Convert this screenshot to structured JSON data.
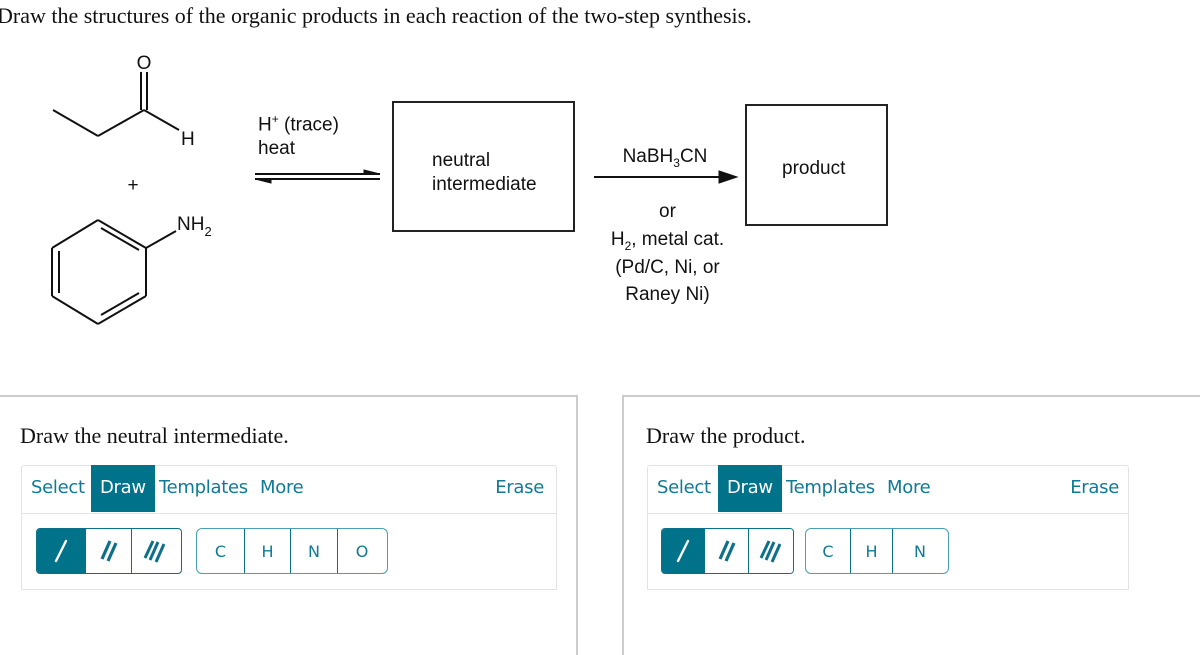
{
  "question": {
    "prompt": "Draw the structures of the organic products in each reaction of the two-step synthesis."
  },
  "scheme": {
    "reactant1": {
      "name": "propanal",
      "atom_O": "O",
      "atom_H": "H"
    },
    "plus": "+",
    "reactant2": {
      "name": "aniline",
      "atom_NH": "NH",
      "atom_NH_sub": "2"
    },
    "step1": {
      "reagent_H": "H",
      "reagent_H_sup": "+",
      "reagent_rest": " (trace)",
      "condition": "heat",
      "arrow": "equilibrium"
    },
    "intermediate_box": {
      "line1": "neutral",
      "line2": "intermediate"
    },
    "step2": {
      "reagent_a": "NaBH",
      "reagent_sub": "3",
      "reagent_b": "CN",
      "or": "or",
      "alt_h": "H",
      "alt_sub": "2",
      "alt_rest": ", metal cat.",
      "alt_line2": "(Pd/C, Ni, or",
      "alt_line3": "Raney Ni)"
    },
    "product_box": {
      "label": "product"
    }
  },
  "panels": [
    {
      "title": "Draw the neutral intermediate.",
      "tabs": [
        "Select",
        "Draw",
        "Templates",
        "More"
      ],
      "active_tab": "Draw",
      "erase": "Erase",
      "bonds": [
        "single-bond",
        "double-bond",
        "triple-bond"
      ],
      "active_bond": "single-bond",
      "atoms": [
        "C",
        "H",
        "N",
        "O"
      ]
    },
    {
      "title": "Draw the product.",
      "tabs": [
        "Select",
        "Draw",
        "Templates",
        "More"
      ],
      "active_tab": "Draw",
      "erase": "Erase",
      "bonds": [
        "single-bond",
        "double-bond",
        "triple-bond"
      ],
      "active_bond": "single-bond",
      "atoms": [
        "C",
        "H",
        "N"
      ]
    }
  ],
  "colors": {
    "accent": "#00728a",
    "accent_text": "#107a95",
    "panel_border": "#cccccc"
  }
}
